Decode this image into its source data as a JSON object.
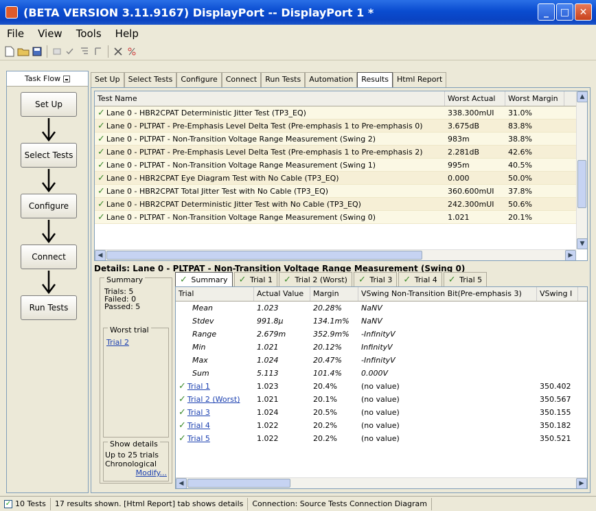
{
  "window": {
    "title": "(BETA VERSION 3.11.9167) DisplayPort -- DisplayPort 1 *"
  },
  "menu": [
    "File",
    "View",
    "Tools",
    "Help"
  ],
  "taskflow": {
    "title": "Task Flow",
    "steps": [
      "Set Up",
      "Select Tests",
      "Configure",
      "Connect",
      "Run Tests"
    ]
  },
  "tabs": [
    "Set Up",
    "Select Tests",
    "Configure",
    "Connect",
    "Run Tests",
    "Automation",
    "Results",
    "Html Report"
  ],
  "active_tab": "Results",
  "results": {
    "headers": [
      "Test Name",
      "Worst Actual",
      "Worst Margin"
    ],
    "rows": [
      [
        "Lane 0 - HBR2CPAT Deterministic Jitter Test (TP3_EQ)",
        "338.300mUI",
        "31.0%"
      ],
      [
        "Lane 0 - PLTPAT - Pre-Emphasis Level Delta Test (Pre-emphasis 1 to Pre-emphasis 0)",
        "3.675dB",
        "83.8%"
      ],
      [
        "Lane 0 - PLTPAT - Non-Transition Voltage Range Measurement (Swing 2)",
        "983m",
        "38.8%"
      ],
      [
        "Lane 0 - PLTPAT - Pre-Emphasis Level Delta Test (Pre-emphasis 1 to Pre-emphasis 2)",
        "2.281dB",
        "42.6%"
      ],
      [
        "Lane 0 - PLTPAT - Non-Transition Voltage Range Measurement (Swing 1)",
        "995m",
        "40.5%"
      ],
      [
        "Lane 0 - HBR2CPAT  Eye Diagram Test with No Cable (TP3_EQ)",
        "0.000",
        "50.0%"
      ],
      [
        "Lane 0 - HBR2CPAT Total Jitter Test with No Cable (TP3_EQ)",
        "360.600mUI",
        "37.8%"
      ],
      [
        "Lane 0 - HBR2CPAT Deterministic Jitter Test with No Cable (TP3_EQ)",
        "242.300mUI",
        "50.6%"
      ],
      [
        "Lane 0 - PLTPAT - Non-Transition Voltage Range Measurement (Swing 0)",
        "1.021",
        "20.1%"
      ]
    ]
  },
  "details": {
    "title": "Details: Lane 0 - PLTPAT - Non-Transition Voltage Range Measurement (Swing 0)",
    "summary": {
      "legend": "Summary",
      "trials": "Trials: 5",
      "failed": "Failed: 0",
      "passed": "Passed: 5",
      "worst_legend": "Worst trial",
      "worst_link": "Trial 2",
      "show_legend": "Show details",
      "show_line1": "Up to 25 trials",
      "show_line2": "Chronological",
      "modify": "Modify..."
    },
    "tabs": [
      "Summary",
      "Trial 1",
      "Trial 2 (Worst)",
      "Trial 3",
      "Trial 4",
      "Trial 5"
    ],
    "headers": [
      "Trial",
      "Actual Value",
      "Margin",
      "VSwing Non-Transition Bit(Pre-emphasis 3)",
      "VSwing I"
    ],
    "stats": [
      [
        "Mean",
        "1.023",
        "20.28%",
        "NaNV"
      ],
      [
        "Stdev",
        "991.8µ",
        "134.1m%",
        "NaNV"
      ],
      [
        "Range",
        "2.679m",
        "352.9m%",
        "-InfinityV"
      ],
      [
        "Min",
        "1.021",
        "20.12%",
        "InfinityV"
      ],
      [
        "Max",
        "1.024",
        "20.47%",
        "-InfinityV"
      ],
      [
        "Sum",
        "5.113",
        "101.4%",
        "0.000V"
      ]
    ],
    "trials": [
      [
        "Trial 1",
        "1.023",
        "20.4%",
        "(no value)",
        "350.402"
      ],
      [
        "Trial 2 (Worst)",
        "1.021",
        "20.1%",
        "(no value)",
        "350.567"
      ],
      [
        "Trial 3",
        "1.024",
        "20.5%",
        "(no value)",
        "350.155"
      ],
      [
        "Trial 4",
        "1.022",
        "20.2%",
        "(no value)",
        "350.182"
      ],
      [
        "Trial 5",
        "1.022",
        "20.2%",
        "(no value)",
        "350.521"
      ]
    ]
  },
  "status": {
    "tests": "10 Tests",
    "shown": "17 results shown. [Html Report] tab shows details",
    "connection": "Connection: Source Tests Connection Diagram"
  }
}
